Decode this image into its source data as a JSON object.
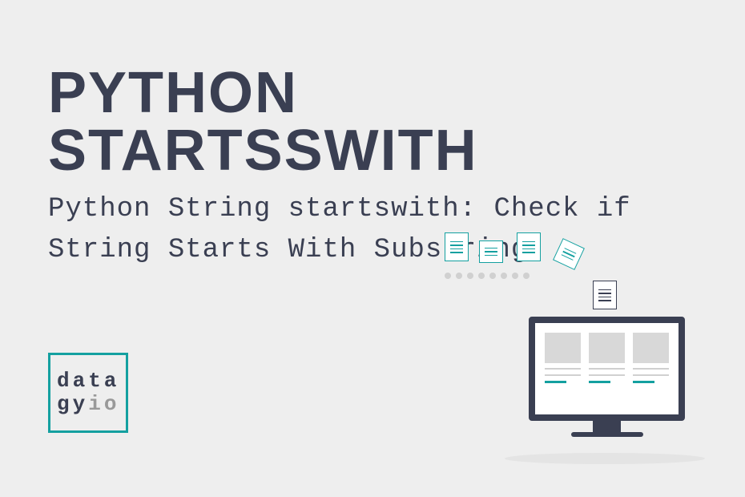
{
  "title": "PYTHON STARTSSWITH",
  "subtitle": "Python String startswith: Check if String Starts With Substring",
  "logo": {
    "line1": "data",
    "line2a": "gy",
    "line2b": "io"
  },
  "colors": {
    "background": "#eeeeee",
    "text_dark": "#3a3f52",
    "accent_teal": "#14a0a0",
    "text_grey": "#999999"
  }
}
